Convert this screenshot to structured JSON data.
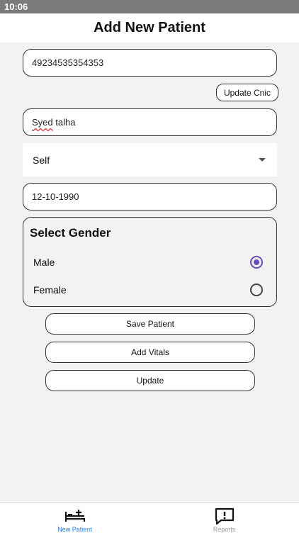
{
  "status_bar": {
    "time": "10:06"
  },
  "header": {
    "title": "Add New Patient"
  },
  "form": {
    "cnic_value": "49234535354353",
    "update_cnic_label": "Update Cnic",
    "name_first": "Syed",
    "name_rest": " talha",
    "relation_selected": "Self",
    "dob_value": "12-10-1990",
    "gender": {
      "title": "Select Gender",
      "options": [
        {
          "label": "Male",
          "checked": true
        },
        {
          "label": "Female",
          "checked": false
        }
      ]
    },
    "save_label": "Save Patient",
    "vitals_label": "Add Vitals",
    "update_label": "Update"
  },
  "colors": {
    "accent": "#6a4cb3",
    "nav_active": "#2a7de1"
  },
  "bottom_nav": {
    "items": [
      {
        "label": "New Patient",
        "icon": "bed-plus-icon",
        "active": true
      },
      {
        "label": "Reports",
        "icon": "report-alert-icon",
        "active": false
      }
    ]
  }
}
